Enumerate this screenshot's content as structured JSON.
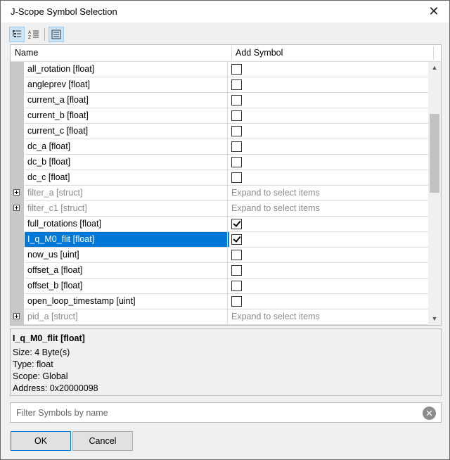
{
  "window": {
    "title": "J-Scope Symbol Selection"
  },
  "toolbar": {
    "buttons": [
      "tree-view-icon",
      "sort-icon",
      "list-view-icon"
    ]
  },
  "table": {
    "columns": {
      "name": "Name",
      "add": "Add Symbol"
    },
    "expand_text": "Expand to select items",
    "rows": [
      {
        "name": "all_rotation [float]",
        "kind": "leaf",
        "checked": false
      },
      {
        "name": "angleprev [float]",
        "kind": "leaf",
        "checked": false
      },
      {
        "name": "current_a [float]",
        "kind": "leaf",
        "checked": false
      },
      {
        "name": "current_b [float]",
        "kind": "leaf",
        "checked": false
      },
      {
        "name": "current_c [float]",
        "kind": "leaf",
        "checked": false
      },
      {
        "name": "dc_a [float]",
        "kind": "leaf",
        "checked": false
      },
      {
        "name": "dc_b [float]",
        "kind": "leaf",
        "checked": false
      },
      {
        "name": "dc_c [float]",
        "kind": "leaf",
        "checked": false
      },
      {
        "name": "filter_a [struct]",
        "kind": "struct",
        "checked": false
      },
      {
        "name": "filter_c1 [struct]",
        "kind": "struct",
        "checked": false
      },
      {
        "name": "full_rotations [float]",
        "kind": "leaf",
        "checked": true
      },
      {
        "name": "I_q_M0_flit [float]",
        "kind": "leaf",
        "checked": true,
        "selected": true
      },
      {
        "name": "now_us [uint]",
        "kind": "leaf",
        "checked": false
      },
      {
        "name": "offset_a [float]",
        "kind": "leaf",
        "checked": false
      },
      {
        "name": "offset_b [float]",
        "kind": "leaf",
        "checked": false
      },
      {
        "name": "open_loop_timestamp [uint]",
        "kind": "leaf",
        "checked": false
      },
      {
        "name": "pid_a [struct]",
        "kind": "struct",
        "checked": false
      }
    ]
  },
  "detail": {
    "title": "I_q_M0_flit [float]",
    "size": "Size:  4 Byte(s)",
    "type": "Type:  float",
    "scope": "Scope:  Global",
    "address": "Address: 0x20000098"
  },
  "filter": {
    "placeholder": "Filter Symbols by name",
    "value": ""
  },
  "buttons": {
    "ok": "OK",
    "cancel": "Cancel"
  },
  "colors": {
    "selection": "#0078d7",
    "struct_text": "#8c8c8c"
  }
}
